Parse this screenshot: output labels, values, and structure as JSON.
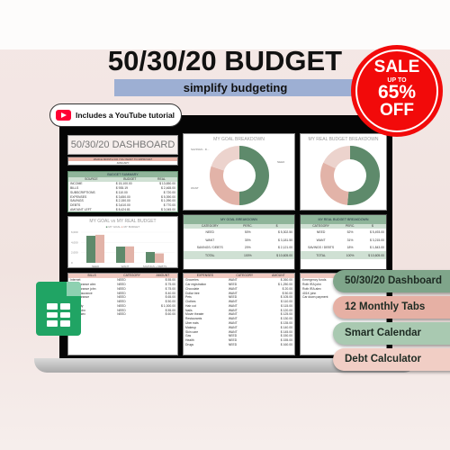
{
  "header": {
    "title": "50/30/20 BUDGET",
    "subtitle": "simplify budgeting",
    "youtube_badge": "Includes a YouTube tutorial"
  },
  "sale": {
    "line1": "SALE",
    "line2": "UP TO",
    "line3": "65%",
    "line4": "OFF",
    "color": "#f20a0a"
  },
  "features": [
    "50/30/20 Dashboard",
    "12 Monthly Tabs",
    "Smart Calendar",
    "Debt Calculator"
  ],
  "dashboard": {
    "title": "50/30/20 DASHBOARD",
    "month_prompt": "WHICH MONTH DO YOU WANT TO IMPROVE?",
    "month_value": "JANUARY",
    "summary": {
      "title": "BUDGET SUMMARY",
      "headers": [
        "SOURCE",
        "BUDGET",
        "REAL"
      ],
      "rows": [
        [
          "INCOME",
          "$ 15,100.00",
          "$ 13,650.00"
        ],
        [
          "BILLS",
          "$ 935.19",
          "$ 2,465.00"
        ],
        [
          "SUBSCRIPTIONS",
          "$ 110.00",
          "$ 720.00"
        ],
        [
          "EXPENSES",
          "$ 3,650.00",
          "$ 5,390.00"
        ],
        [
          "SAVINGS",
          "$ 2,150.00",
          "$ 1,090.00"
        ],
        [
          "DEBTS",
          "$ 3,610.00",
          "$ 770.00"
        ],
        [
          "AMOUNT LEFT",
          "$ 8,424.81",
          "$ 3,045.00"
        ]
      ]
    },
    "goal_donut": {
      "title": "MY GOAL BREAKDOWN",
      "labels": [
        "NEED",
        "WANT",
        "SAVINGS - D..."
      ],
      "values": [
        50,
        30,
        20
      ],
      "colors": [
        "#5e8a6b",
        "#e2b3a8",
        "#ecd3cd"
      ]
    },
    "real_donut": {
      "title": "MY REAL BUDGET BREAKDOWN",
      "values": [
        52,
        31,
        18
      ]
    },
    "bar_chart": {
      "title": "MY GOAL vs MY REAL BUDGET",
      "legend": [
        "MY GOAL",
        "MY BUDGET"
      ],
      "yticks": [
        "6,000",
        "4,000",
        "2,000",
        "0"
      ],
      "categories": [
        "NEED",
        "WANT",
        "SAVINGS + DEBTS"
      ],
      "goal": [
        5302,
        3181,
        2121
      ],
      "real": [
        5493,
        3215,
        1843
      ]
    },
    "goal_table": {
      "title": "MY GOAL BREAKDOWN",
      "headers": [
        "CATEGORY",
        "PERC.",
        "$"
      ],
      "rows": [
        [
          "NEED",
          "50%",
          "$ 5,302.50"
        ],
        [
          "WANT",
          "30%",
          "$ 3,181.50"
        ],
        [
          "SAVINGS / DEBTS",
          "20%",
          "$ 2,121.00"
        ],
        [
          "TOTAL",
          "100%",
          "$ 10,605.00"
        ]
      ]
    },
    "real_table": {
      "title": "MY REAL BUDGET BREAKDOWN",
      "headers": [
        "CATEGORY",
        "PERC.",
        "$"
      ],
      "rows": [
        [
          "NEED",
          "52%",
          "$ 5,493.00"
        ],
        [
          "WANT",
          "31%",
          "$ 3,215.00"
        ],
        [
          "SAVINGS / DEBTS",
          "18%",
          "$ 1,843.00"
        ],
        [
          "TOTAL",
          "100%",
          "$ 10,605.00"
        ]
      ]
    },
    "bills": {
      "headers": [
        "BILLS",
        "CATEGORY",
        "AMOUNT"
      ],
      "rows": [
        [
          "Internet",
          "NEED",
          "$ 55.00"
        ],
        [
          "Life insurance alex",
          "NEED",
          "$ 75.00"
        ],
        [
          "Life insurance john",
          "NEED",
          "$ 75.00"
        ],
        [
          "Home insurance",
          "NEED",
          "$ 40.00"
        ],
        [
          "Car insurance",
          "NEED",
          "$ 65.00"
        ],
        [
          "HOA",
          "NEED",
          "$ 50.00"
        ],
        [
          "Electricity",
          "NEED",
          "$ 1,000.00"
        ],
        [
          "Phone john",
          "NEED",
          "$ 55.00"
        ],
        [
          "Phone alex",
          "NEED",
          "$ 60.00"
        ]
      ]
    },
    "expenses": {
      "headers": [
        "EXPENSES",
        "CATEGORY",
        "AMOUNT"
      ],
      "rows": [
        [
          "Groceries",
          "WANT",
          "$ 260.00"
        ],
        [
          "Car registration",
          "NEED",
          "$ 1,250.00"
        ],
        [
          "Chocolate",
          "WANT",
          "$ 20.00"
        ],
        [
          "Dollar tree",
          "WANT",
          "$ 50.00"
        ],
        [
          "Pets",
          "NEED",
          "$ 105.00"
        ],
        [
          "Clothes",
          "WANT",
          "$ 110.00"
        ],
        [
          "Hair cut",
          "WANT",
          "$ 115.00"
        ],
        [
          "Nails",
          "WANT",
          "$ 120.00"
        ],
        [
          "Movie theater",
          "WANT",
          "$ 125.00"
        ],
        [
          "Restaurants",
          "WANT",
          "$ 130.00"
        ],
        [
          "Uber eats",
          "WANT",
          "$ 135.00"
        ],
        [
          "Makeup",
          "WANT",
          "$ 140.00"
        ],
        [
          "Skin care",
          "WANT",
          "$ 145.00"
        ],
        [
          "Gas",
          "NEED",
          "$ 150.00"
        ],
        [
          "Health",
          "NEED",
          "$ 155.00"
        ],
        [
          "Drugs",
          "NEED",
          "$ 160.00"
        ]
      ]
    },
    "savings": {
      "headers": [
        "SAVINGS"
      ],
      "rows": [
        "Emergency funds",
        "Roth IRA john",
        "Roth IRA alex",
        "401K john",
        "Car down payment"
      ]
    }
  }
}
